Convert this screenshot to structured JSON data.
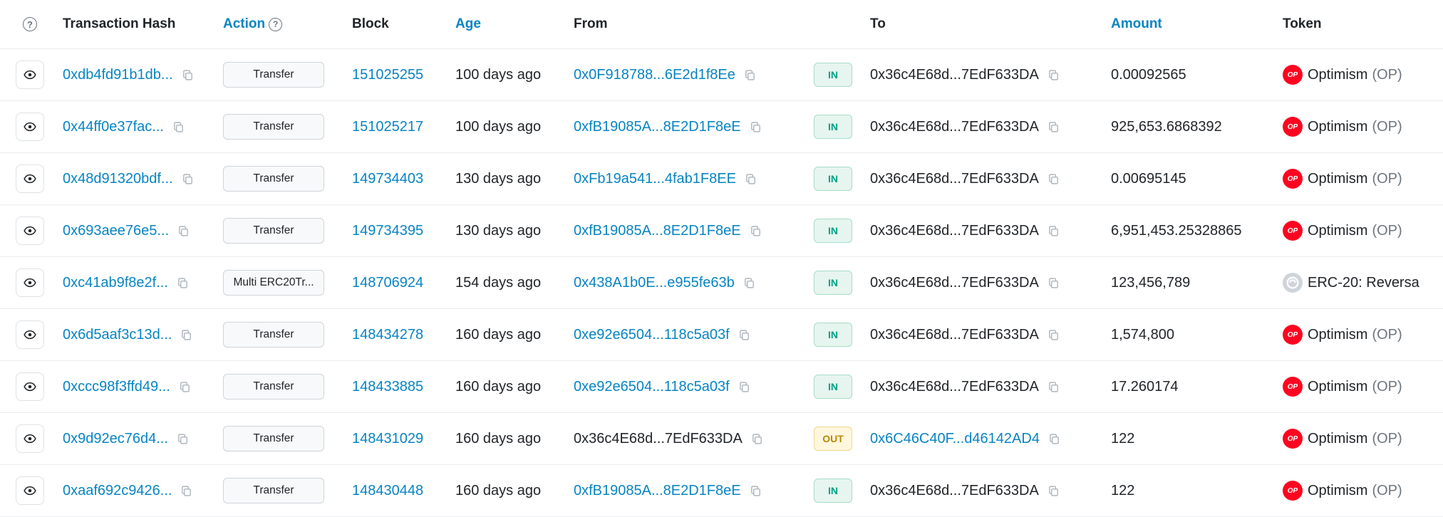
{
  "header": {
    "tx_hash": "Transaction Hash",
    "action": "Action",
    "block": "Block",
    "age": "Age",
    "from": "From",
    "to": "To",
    "amount": "Amount",
    "token": "Token"
  },
  "rows": [
    {
      "hash": "0xdb4fd91b1db...",
      "action": "Transfer",
      "block": "151025255",
      "age": "100 days ago",
      "from": "0x0F918788...6E2d1f8Ee",
      "from_link": true,
      "dir": "IN",
      "to": "0x36c4E68d...7EdF633DA",
      "to_link": false,
      "amount": "0.00092565",
      "token_icon": "optimism-icon",
      "token_name": "Optimism",
      "token_symbol": "(OP)"
    },
    {
      "hash": "0x44ff0e37fac...",
      "action": "Transfer",
      "block": "151025217",
      "age": "100 days ago",
      "from": "0xfB19085A...8E2D1F8eE",
      "from_link": true,
      "dir": "IN",
      "to": "0x36c4E68d...7EdF633DA",
      "to_link": false,
      "amount": "925,653.6868392",
      "token_icon": "optimism-icon",
      "token_name": "Optimism",
      "token_symbol": "(OP)"
    },
    {
      "hash": "0x48d91320bdf...",
      "action": "Transfer",
      "block": "149734403",
      "age": "130 days ago",
      "from": "0xFb19a541...4fab1F8EE",
      "from_link": true,
      "dir": "IN",
      "to": "0x36c4E68d...7EdF633DA",
      "to_link": false,
      "amount": "0.00695145",
      "token_icon": "optimism-icon",
      "token_name": "Optimism",
      "token_symbol": "(OP)"
    },
    {
      "hash": "0x693aee76e5...",
      "action": "Transfer",
      "block": "149734395",
      "age": "130 days ago",
      "from": "0xfB19085A...8E2D1F8eE",
      "from_link": true,
      "dir": "IN",
      "to": "0x36c4E68d...7EdF633DA",
      "to_link": false,
      "amount": "6,951,453.25328865",
      "token_icon": "optimism-icon",
      "token_name": "Optimism",
      "token_symbol": "(OP)"
    },
    {
      "hash": "0xc41ab9f8e2f...",
      "action": "Multi ERC20Tr...",
      "block": "148706924",
      "age": "154 days ago",
      "from": "0x438A1b0E...e955fe63b",
      "from_link": true,
      "dir": "IN",
      "to": "0x36c4E68d...7EdF633DA",
      "to_link": false,
      "amount": "123,456,789",
      "token_icon": "erc20-icon",
      "token_name": "ERC-20: Reversa",
      "token_symbol": ""
    },
    {
      "hash": "0x6d5aaf3c13d...",
      "action": "Transfer",
      "block": "148434278",
      "age": "160 days ago",
      "from": "0xe92e6504...118c5a03f",
      "from_link": true,
      "dir": "IN",
      "to": "0x36c4E68d...7EdF633DA",
      "to_link": false,
      "amount": "1,574,800",
      "token_icon": "optimism-icon",
      "token_name": "Optimism",
      "token_symbol": "(OP)"
    },
    {
      "hash": "0xccc98f3ffd49...",
      "action": "Transfer",
      "block": "148433885",
      "age": "160 days ago",
      "from": "0xe92e6504...118c5a03f",
      "from_link": true,
      "dir": "IN",
      "to": "0x36c4E68d...7EdF633DA",
      "to_link": false,
      "amount": "17.260174",
      "token_icon": "optimism-icon",
      "token_name": "Optimism",
      "token_symbol": "(OP)"
    },
    {
      "hash": "0x9d92ec76d4...",
      "action": "Transfer",
      "block": "148431029",
      "age": "160 days ago",
      "from": "0x36c4E68d...7EdF633DA",
      "from_link": false,
      "dir": "OUT",
      "to": "0x6C46C40F...d46142AD4",
      "to_link": true,
      "amount": "122",
      "token_icon": "optimism-icon",
      "token_name": "Optimism",
      "token_symbol": "(OP)"
    },
    {
      "hash": "0xaaf692c9426...",
      "action": "Transfer",
      "block": "148430448",
      "age": "160 days ago",
      "from": "0xfB19085A...8E2D1F8eE",
      "from_link": true,
      "dir": "IN",
      "to": "0x36c4E68d...7EdF633DA",
      "to_link": false,
      "amount": "122",
      "token_icon": "optimism-icon",
      "token_name": "Optimism",
      "token_symbol": "(OP)"
    }
  ],
  "icons": {
    "optimism_text": "OP"
  }
}
